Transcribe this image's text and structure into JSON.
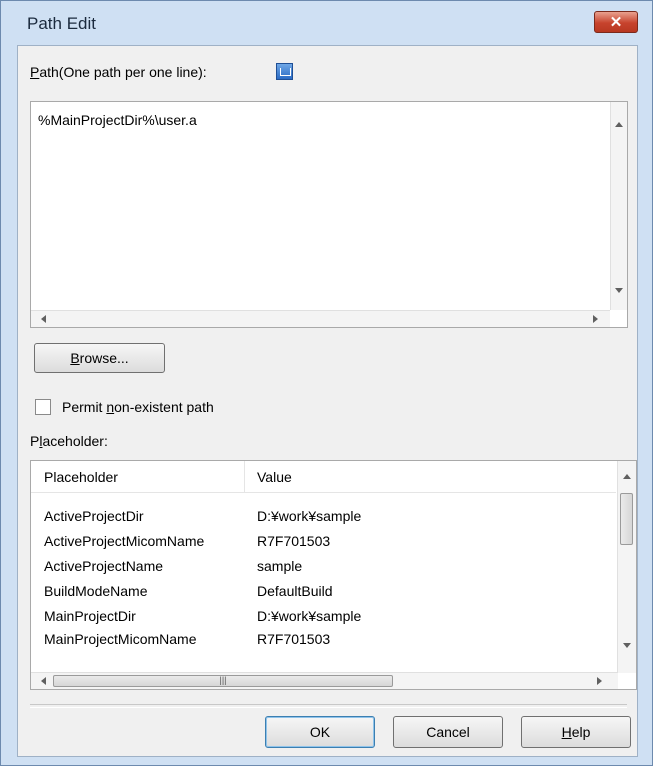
{
  "window": {
    "title": "Path Edit",
    "close_glyph": "✕",
    "accent_color": "#cfe0f3",
    "close_color": "#c7432d"
  },
  "path": {
    "label_mnemonic": "P",
    "label_rest": "ath(One path per one line):",
    "icon": "placeholder-insert-icon",
    "text": "%MainProjectDir%\\user.a"
  },
  "browse_button": {
    "mnemonic": "B",
    "rest": "rowse..."
  },
  "permit": {
    "label_before": "Permit ",
    "label_mnemonic": "n",
    "label_after": "on-existent path",
    "checked": false
  },
  "placeholder_section": {
    "label_before": "P",
    "label_mnemonic": "l",
    "label_after": "aceholder:"
  },
  "table": {
    "columns": [
      "Placeholder",
      "Value"
    ],
    "rows": [
      {
        "name": "ActiveProjectDir",
        "value": "D:¥work¥sample"
      },
      {
        "name": "ActiveProjectMicomName",
        "value": "R7F701503"
      },
      {
        "name": "ActiveProjectName",
        "value": "sample"
      },
      {
        "name": "BuildModeName",
        "value": "DefaultBuild"
      },
      {
        "name": "MainProjectDir",
        "value": "D:¥work¥sample"
      },
      {
        "name": "MainProjectMicomName",
        "value": "R7F701503"
      }
    ],
    "hscroll_grip": "|||"
  },
  "buttons": {
    "ok": "OK",
    "cancel": "Cancel",
    "help_mnemonic": "H",
    "help_rest": "elp"
  }
}
